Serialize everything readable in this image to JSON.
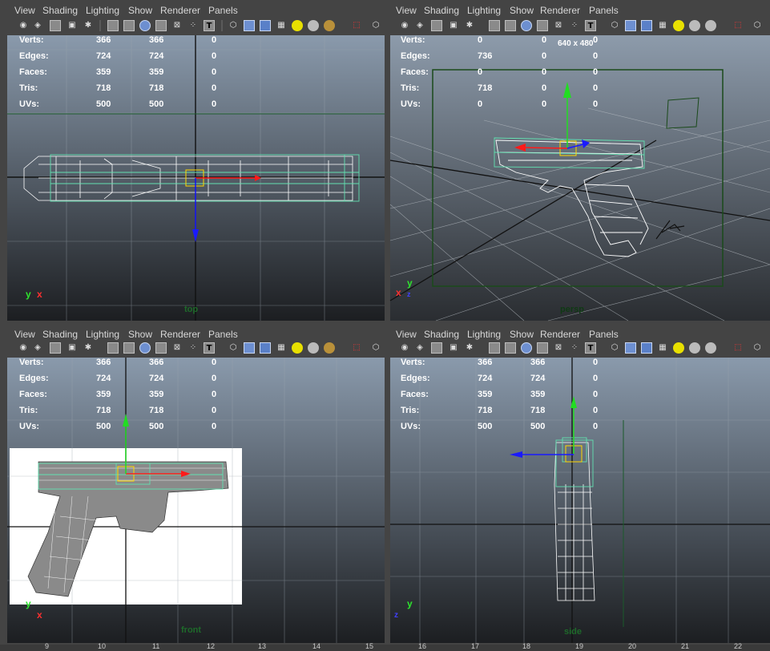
{
  "menu": [
    "View",
    "Shading",
    "Lighting",
    "Show",
    "Renderer",
    "Panels"
  ],
  "stats_labels": [
    "Verts:",
    "Edges:",
    "Faces:",
    "Tris:",
    "UVs:"
  ],
  "viewports": {
    "top": {
      "camera": "top",
      "stats": [
        [
          "366",
          "366",
          "0"
        ],
        [
          "724",
          "724",
          "0"
        ],
        [
          "359",
          "359",
          "0"
        ],
        [
          "718",
          "718",
          "0"
        ],
        [
          "500",
          "500",
          "0"
        ]
      ]
    },
    "persp": {
      "camera": "persp",
      "resolution": "640 x 480",
      "stats": [
        [
          "0",
          "0",
          "0"
        ],
        [
          "736",
          "0",
          "0"
        ],
        [
          "0",
          "0",
          "0"
        ],
        [
          "718",
          "0",
          "0"
        ],
        [
          "0",
          "0",
          "0"
        ]
      ]
    },
    "front": {
      "camera": "front",
      "stats": [
        [
          "366",
          "366",
          "0"
        ],
        [
          "724",
          "724",
          "0"
        ],
        [
          "359",
          "359",
          "0"
        ],
        [
          "718",
          "718",
          "0"
        ],
        [
          "500",
          "500",
          "0"
        ]
      ]
    },
    "side": {
      "camera": "side",
      "stats": [
        [
          "366",
          "366",
          "0"
        ],
        [
          "724",
          "724",
          "0"
        ],
        [
          "359",
          "359",
          "0"
        ],
        [
          "718",
          "718",
          "0"
        ],
        [
          "500",
          "500",
          "0"
        ]
      ]
    }
  },
  "axes": {
    "top": [
      "y",
      "x"
    ],
    "persp": [
      "x",
      "y",
      "z"
    ],
    "front": [
      "y",
      "x"
    ],
    "side": [
      "y",
      "z"
    ]
  },
  "ruler": [
    "9",
    "10",
    "11",
    "12",
    "13",
    "14",
    "15",
    "16",
    "17",
    "18",
    "19",
    "20",
    "21",
    "22"
  ],
  "icons": [
    "camera-icon",
    "camera-attr-icon",
    "bookmark-icon",
    "image-plane-icon",
    "grid-toggle-icon",
    "resolution-gate-icon",
    "film-gate-icon",
    "wireframe-icon",
    "smooth-shade-icon",
    "bounding-box-icon",
    "points-icon",
    "textured-icon",
    "text-icon",
    "isolate-select-icon",
    "xray-icon",
    "default-material-icon",
    "all-lights-icon",
    "shadows-icon",
    "hq-render-icon"
  ],
  "colors": {
    "selected_wire": "#62e0b0",
    "wire": "#ffffff",
    "manip_x": "#ff1a1a",
    "manip_y": "#22dd22",
    "manip_z": "#1a1aff",
    "gate": "#1a4a1a"
  }
}
